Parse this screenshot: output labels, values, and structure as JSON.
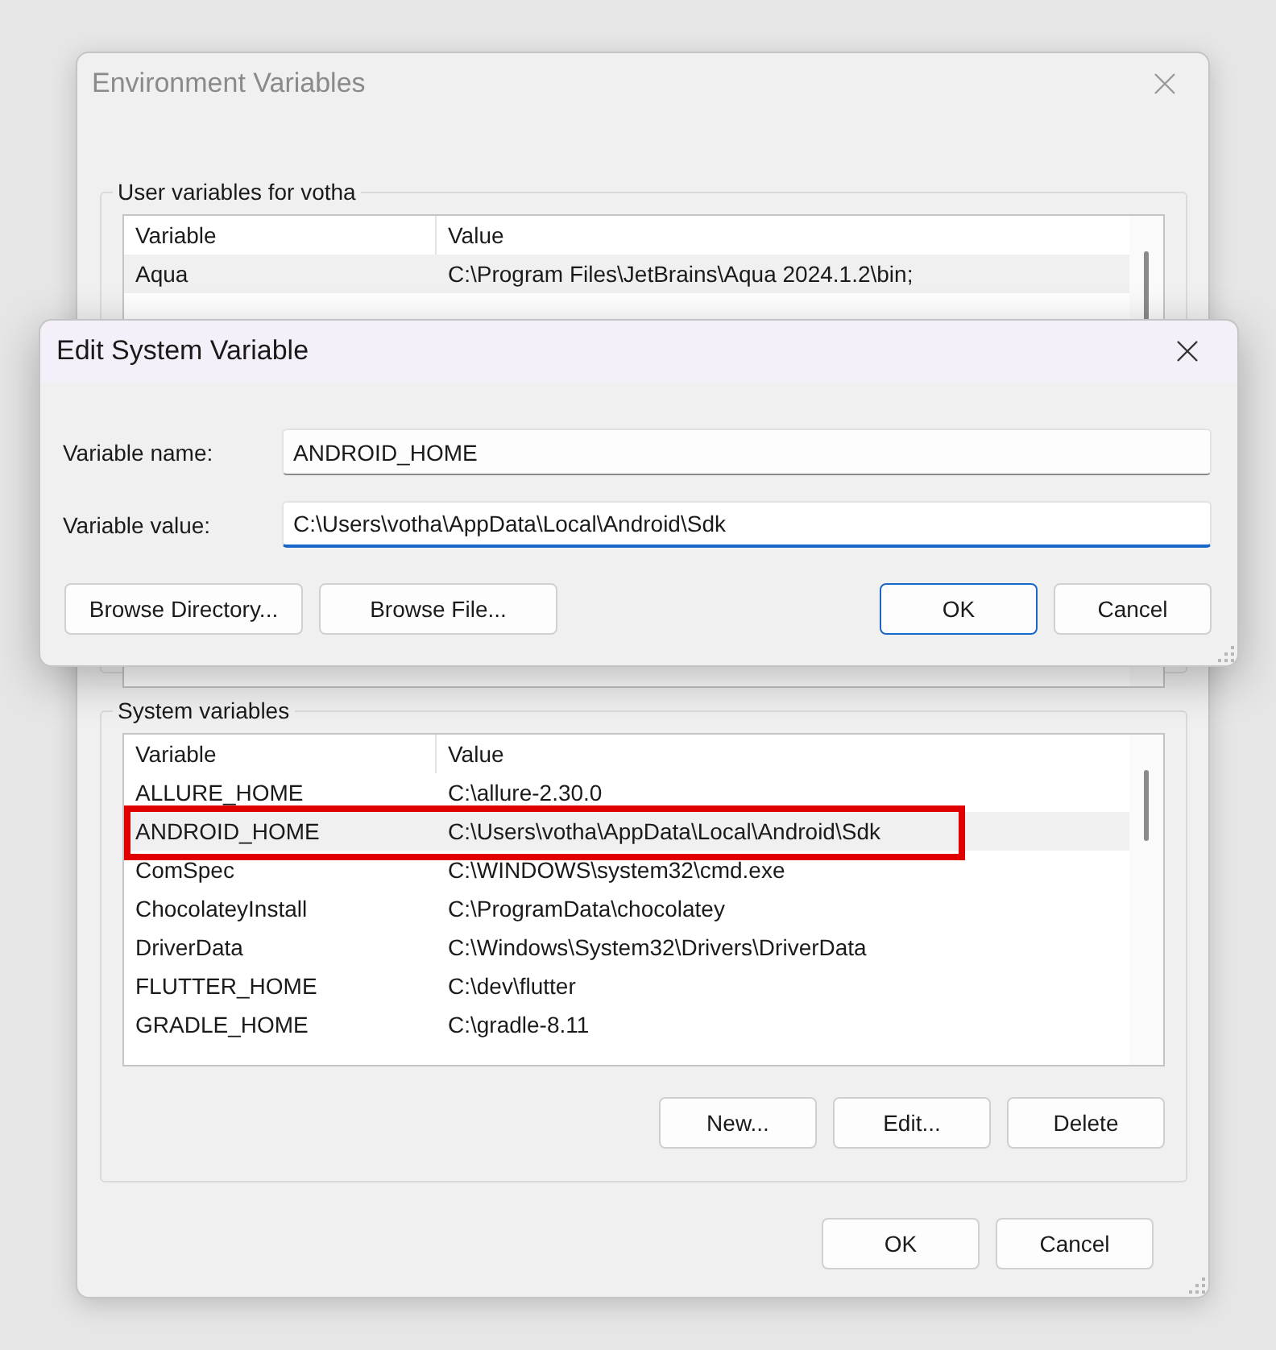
{
  "background_window": {
    "title": "Environment Variables",
    "user_variables": {
      "label": "User variables for votha",
      "columns": [
        "Variable",
        "Value"
      ],
      "rows": [
        {
          "variable": "Aqua",
          "value": "C:\\Program Files\\JetBrains\\Aqua 2024.1.2\\bin;",
          "selected": true,
          "annotated": false
        }
      ]
    },
    "system_variables": {
      "label": "System variables",
      "columns": [
        "Variable",
        "Value"
      ],
      "rows": [
        {
          "variable": "ALLURE_HOME",
          "value": "C:\\allure-2.30.0",
          "selected": false,
          "annotated": false
        },
        {
          "variable": "ANDROID_HOME",
          "value": "C:\\Users\\votha\\AppData\\Local\\Android\\Sdk",
          "selected": true,
          "annotated": true
        },
        {
          "variable": "ComSpec",
          "value": "C:\\WINDOWS\\system32\\cmd.exe",
          "selected": false,
          "annotated": false
        },
        {
          "variable": "ChocolateyInstall",
          "value": "C:\\ProgramData\\chocolatey",
          "selected": false,
          "annotated": false
        },
        {
          "variable": "DriverData",
          "value": "C:\\Windows\\System32\\Drivers\\DriverData",
          "selected": false,
          "annotated": false
        },
        {
          "variable": "FLUTTER_HOME",
          "value": "C:\\dev\\flutter",
          "selected": false,
          "annotated": false
        },
        {
          "variable": "GRADLE_HOME",
          "value": "C:\\gradle-8.11",
          "selected": false,
          "annotated": false
        }
      ],
      "buttons": [
        "New...",
        "Edit...",
        "Delete"
      ]
    },
    "buttons": [
      "OK",
      "Cancel"
    ]
  },
  "dialog": {
    "title": "Edit System Variable",
    "fields": [
      {
        "label": "Variable name:",
        "value": "ANDROID_HOME",
        "focused": false
      },
      {
        "label": "Variable value:",
        "value": "C:\\Users\\votha\\AppData\\Local\\Android\\Sdk",
        "focused": true
      }
    ],
    "buttons": [
      {
        "label": "Browse Directory...",
        "default": false
      },
      {
        "label": "Browse File...",
        "default": false
      },
      {
        "label": "OK",
        "default": true
      },
      {
        "label": "Cancel",
        "default": false
      }
    ]
  }
}
